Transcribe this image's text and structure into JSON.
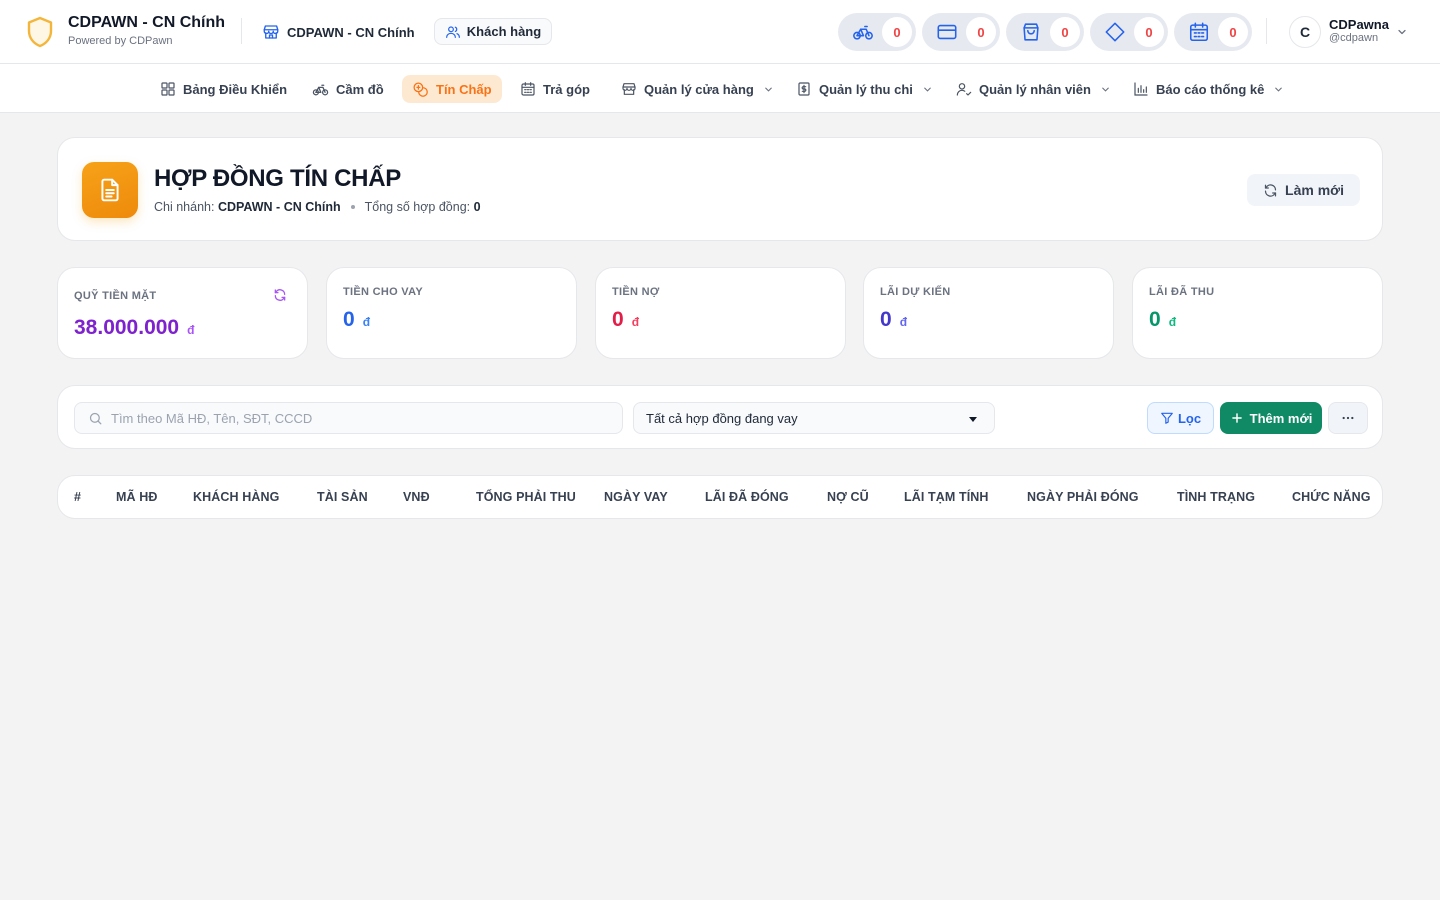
{
  "header": {
    "brand_title": "CDPAWN - CN Chính",
    "brand_sub": "Powered by CDPawn",
    "branch_label": "CDPAWN - CN Chính",
    "customer_button": "Khách hàng",
    "stat_pills": [
      {
        "icon": "bicycle-icon",
        "count": "0"
      },
      {
        "icon": "credit-card-icon",
        "count": "0"
      },
      {
        "icon": "shopping-bag-icon",
        "count": "0"
      },
      {
        "icon": "diamond-icon",
        "count": "0"
      },
      {
        "icon": "calendar-icon",
        "count": "0"
      }
    ],
    "user": {
      "initial": "C",
      "name": "CDPawna",
      "handle": "@cdpawn"
    }
  },
  "nav": {
    "items": [
      {
        "label": "Bảng Điều Khiển",
        "icon": "dashboard-icon"
      },
      {
        "label": "Cầm đồ",
        "icon": "bicycle-icon"
      },
      {
        "label": "Tín Chấp",
        "icon": "coins-icon",
        "active": true
      },
      {
        "label": "Trả góp",
        "icon": "calendar-icon"
      },
      {
        "label": "Quản lý cửa hàng",
        "icon": "store-icon",
        "dropdown": true
      },
      {
        "label": "Quản lý thu chi",
        "icon": "receipt-icon",
        "dropdown": true
      },
      {
        "label": "Quản lý nhân viên",
        "icon": "user-check-icon",
        "dropdown": true
      },
      {
        "label": "Báo cáo thống kê",
        "icon": "bar-chart-icon",
        "dropdown": true
      }
    ]
  },
  "page": {
    "title": "HỢP ĐỒNG TÍN CHẤP",
    "branch_prefix": "Chi nhánh:",
    "branch_name": "CDPAWN - CN Chính",
    "total_prefix": "Tổng số hợp đồng:",
    "total_count": "0",
    "refresh_label": "Làm mới"
  },
  "stats": [
    {
      "label": "QUỸ TIỀN MẶT",
      "value": "38.000.000",
      "unit": "đ",
      "color": "#7e22ce"
    },
    {
      "label": "TIỀN CHO VAY",
      "value": "0",
      "unit": "đ",
      "color": "#2563eb"
    },
    {
      "label": "TIỀN NỢ",
      "value": "0",
      "unit": "đ",
      "color": "#e11d48"
    },
    {
      "label": "LÃI DỰ KIẾN",
      "value": "0",
      "unit": "đ",
      "color": "#4338ca"
    },
    {
      "label": "LÃI ĐÃ THU",
      "value": "0",
      "unit": "đ",
      "color": "#059669"
    }
  ],
  "filters": {
    "search_placeholder": "Tìm theo Mã HĐ, Tên, SĐT, CCCD",
    "search_value": "",
    "status_selected": "Tất cả hợp đồng đang vay",
    "filter_label": "Lọc",
    "add_label": "Thêm mới"
  },
  "table": {
    "columns": [
      "#",
      "MÃ HĐ",
      "KHÁCH HÀNG",
      "TÀI SẢN",
      "VNĐ",
      "TỔNG PHẢI THU",
      "NGÀY VAY",
      "LÃI ĐÃ ĐÓNG",
      "NỢ CŨ",
      "LÃI TẠM TÍNH",
      "NGÀY PHẢI ĐÓNG",
      "TÌNH TRẠNG",
      "CHỨC NĂNG"
    ],
    "rows": []
  }
}
